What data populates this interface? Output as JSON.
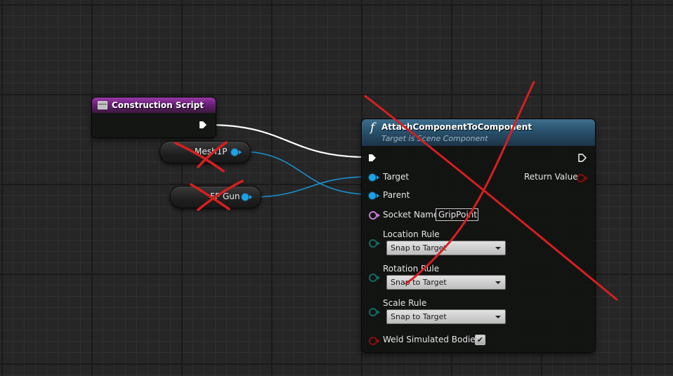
{
  "construction_script": {
    "title": "Construction Script",
    "icon": "function-entry-icon"
  },
  "variables": {
    "mesh": {
      "label": "Mesh1P"
    },
    "gun": {
      "label": "FP Gun"
    }
  },
  "attach_node": {
    "title": "AttachComponentToComponent",
    "subtitle": "Target is Scene Component",
    "target_label": "Target",
    "parent_label": "Parent",
    "return_label": "Return Value",
    "socket_label": "Socket Name",
    "socket_value": "GripPoint",
    "location_rule_label": "Location Rule",
    "location_rule_value": "Snap to Target",
    "rotation_rule_label": "Rotation Rule",
    "rotation_rule_value": "Snap to Target",
    "scale_rule_label": "Scale Rule",
    "scale_rule_value": "Snap to Target",
    "weld_label": "Weld Simulated Bodies",
    "weld_checked": true
  },
  "colors": {
    "object_pin": "#1aa3e8",
    "name_pin": "#c37ad9",
    "enum_pin": "#0f6b62",
    "bool_pin": "#8c0d0d",
    "exec_wire": "#ffffff",
    "annotation_strokes": "#d81f1f"
  }
}
